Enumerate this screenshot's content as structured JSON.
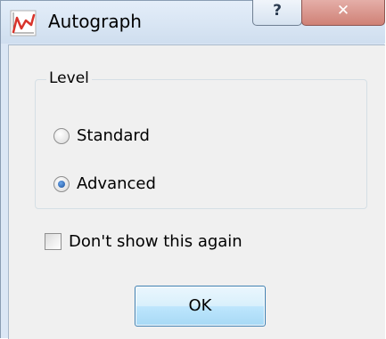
{
  "window": {
    "title": "Autograph",
    "help_glyph": "?",
    "close_glyph": "✕",
    "icon": "autograph-graph-icon",
    "accent_color": "#d9342b"
  },
  "level_group": {
    "legend": "Level",
    "options": [
      {
        "label": "Standard",
        "selected": false
      },
      {
        "label": "Advanced",
        "selected": true
      }
    ]
  },
  "dont_show": {
    "label": "Don't show this again",
    "checked": false
  },
  "ok_button": {
    "label": "OK"
  }
}
